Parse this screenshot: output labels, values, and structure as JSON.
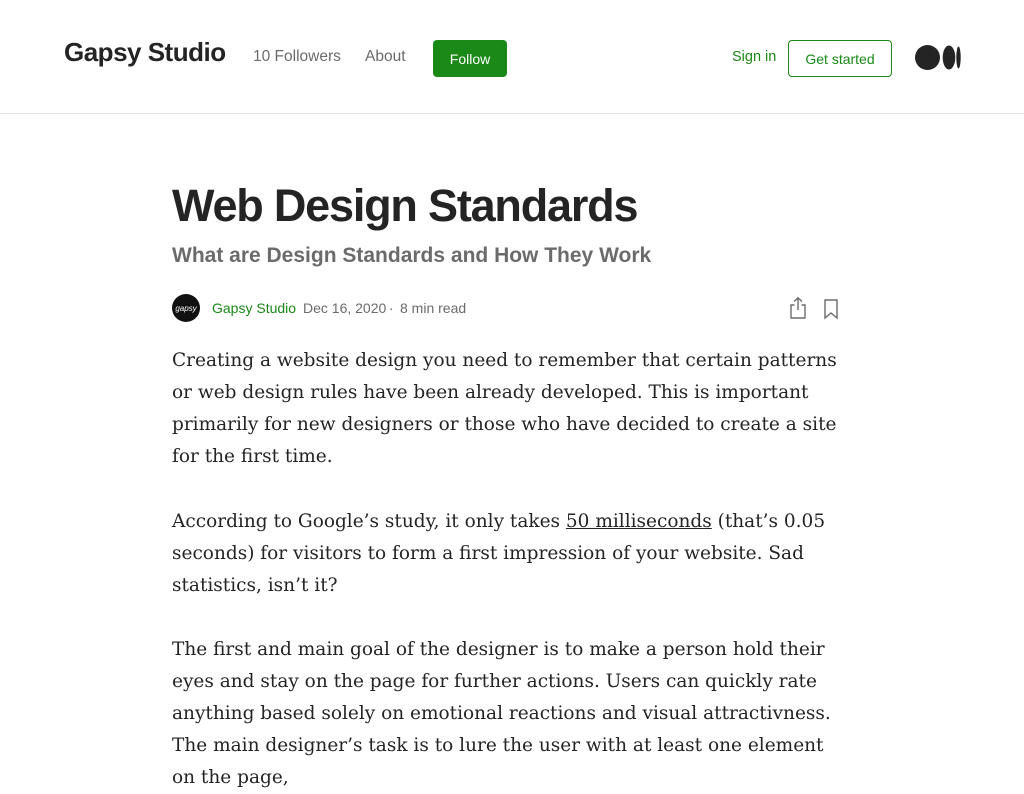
{
  "header": {
    "publication_name": "Gapsy Studio",
    "followers": "10 Followers",
    "about": "About",
    "follow": "Follow",
    "sign_in": "Sign in",
    "get_started": "Get started",
    "logo_icon": "medium-logo-icon"
  },
  "article": {
    "title": "Web Design Standards",
    "subtitle": "What are Design Standards and How They Work",
    "author": {
      "avatar_text": "gapsy",
      "name": "Gapsy Studio",
      "date": "Dec 16, 2020",
      "separator": "·",
      "read_time": "8 min read"
    },
    "actions": {
      "share_icon": "share-icon",
      "bookmark_icon": "bookmark-icon"
    },
    "paragraphs": {
      "p1": "Creating a website design you need to remember that certain patterns or web design rules have been already developed. This is important primarily for new designers or those who have decided to create a site for the first time.",
      "p2_before": "According to Google’s study, it only takes ",
      "p2_link": "50 milliseconds",
      "p2_after": " (that’s 0.05 seconds) for visitors to form a first impression of your website. Sad statistics, isn’t it?",
      "p3": "The first and main goal of the designer is to make a person hold their eyes and stay on the page for further actions. Users can quickly rate anything based solely on emotional reactions and visual attractivness. The main designer’s task is to lure the user with at least one element on the page,"
    }
  },
  "colors": {
    "accent_green": "#1a8917",
    "text_primary": "#242424",
    "text_secondary": "#6b6b6b",
    "divider": "#e6e6e6"
  }
}
